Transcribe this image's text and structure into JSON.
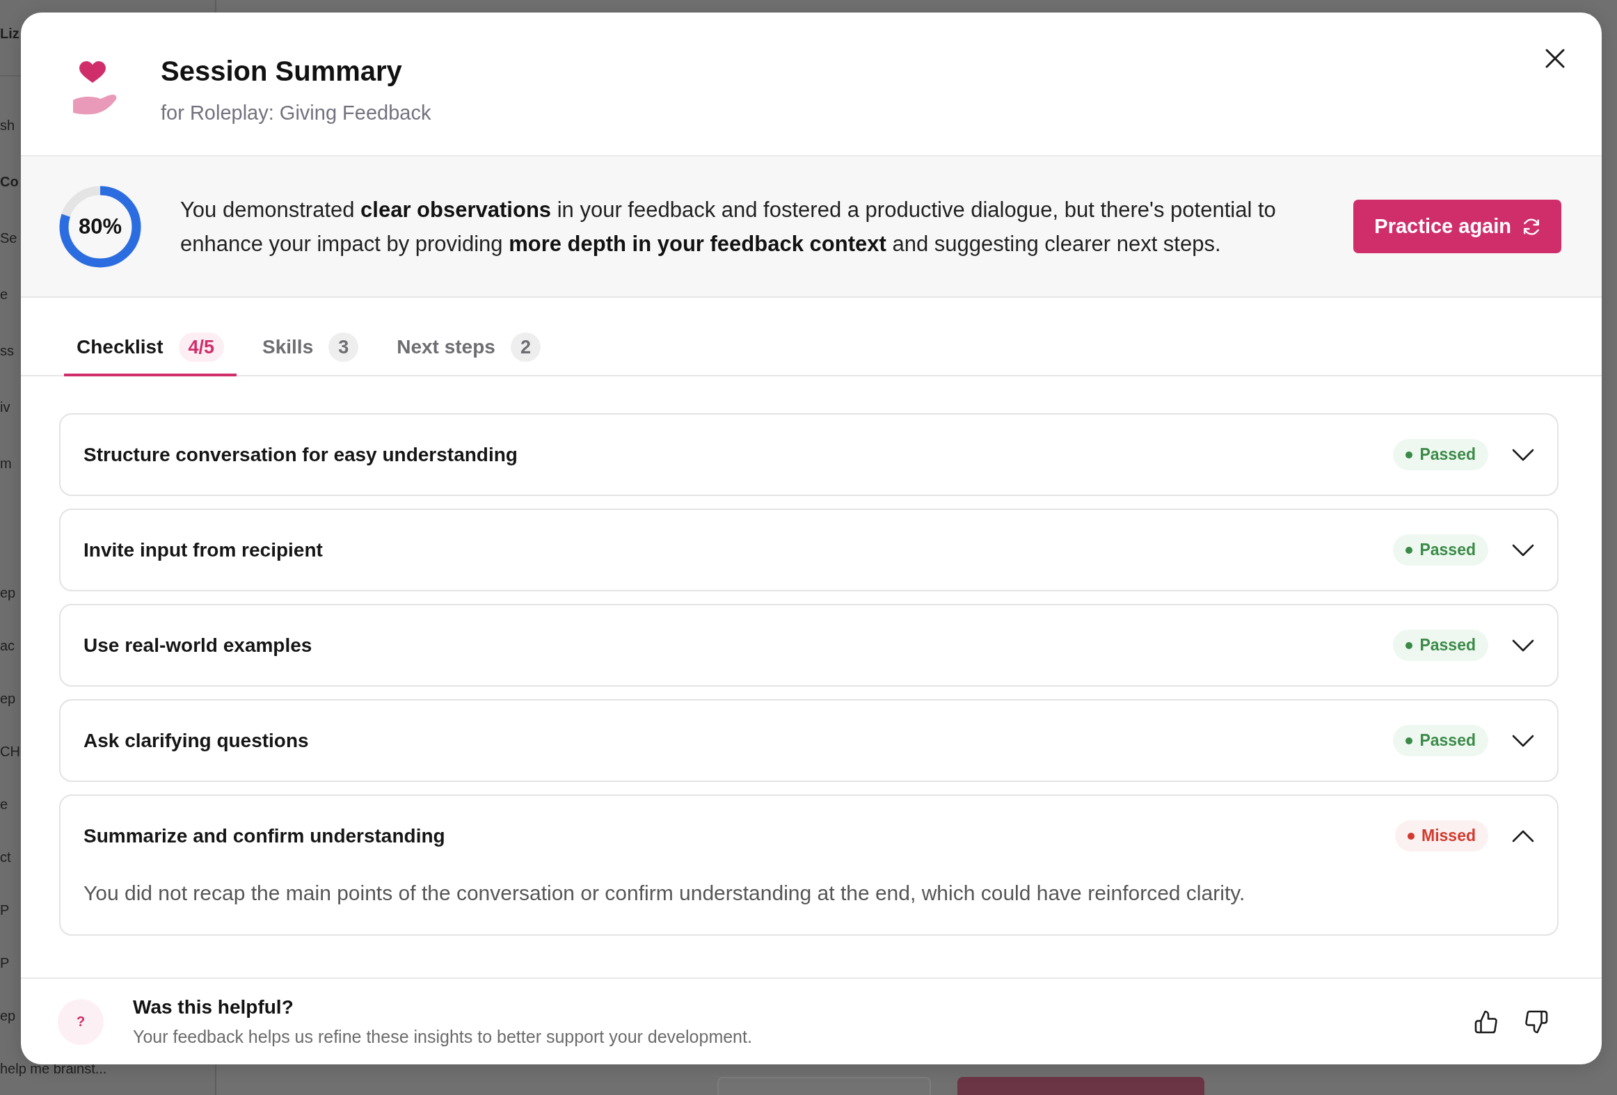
{
  "backdrop": {
    "sidebar": {
      "groups": [
        {
          "items": [
            {
              "text": "Liz",
              "kind": "heading"
            }
          ]
        },
        {
          "items": [
            {
              "text": "sh",
              "kind": "item"
            },
            {
              "text": "Co",
              "kind": "heading"
            },
            {
              "text": "Se",
              "kind": "item"
            },
            {
              "text": "e",
              "kind": "item"
            },
            {
              "text": "ss",
              "kind": "item"
            },
            {
              "text": "iv",
              "kind": "item"
            },
            {
              "text": "m",
              "kind": "item"
            }
          ]
        },
        {
          "items": [
            {
              "text": "ep",
              "kind": "item"
            },
            {
              "text": "ac",
              "kind": "item"
            },
            {
              "text": "ep",
              "kind": "item"
            },
            {
              "text": "CH",
              "kind": "item"
            },
            {
              "text": "e",
              "kind": "item"
            },
            {
              "text": "ct",
              "kind": "item"
            },
            {
              "text": "P",
              "kind": "item"
            },
            {
              "text": "P",
              "kind": "item"
            },
            {
              "text": "ep",
              "kind": "item"
            },
            {
              "text": "help me brainst...",
              "kind": "item"
            }
          ]
        }
      ]
    }
  },
  "dialog": {
    "title": "Session Summary",
    "subtitle": "for Roleplay: Giving Feedback",
    "summary": {
      "score": "80%",
      "text": "You demonstrated **clear observations** in your feedback and fostered a productive dialogue, but there's potential to enhance your impact by providing **more depth in your feedback context** and suggesting clearer next steps.",
      "action": "Practice again"
    },
    "tabs": [
      {
        "label": "Checklist",
        "count": "4/5",
        "selected": true
      },
      {
        "label": "Skills",
        "count": "3",
        "selected": false
      },
      {
        "label": "Next steps",
        "count": "2",
        "selected": false
      }
    ],
    "checklist": [
      {
        "title": "Structure conversation for easy understanding",
        "passed": true,
        "status_label": "Passed",
        "expanded": false
      },
      {
        "title": "Invite input from recipient",
        "passed": true,
        "status_label": "Passed",
        "expanded": false
      },
      {
        "title": "Use real-world examples",
        "passed": true,
        "status_label": "Passed",
        "expanded": false
      },
      {
        "title": "Ask clarifying questions",
        "passed": true,
        "status_label": "Passed",
        "expanded": false
      },
      {
        "title": "Summarize and confirm understanding",
        "passed": false,
        "status_label": "Missed",
        "expanded": true,
        "detail": "You did not recap the main points of the conversation or confirm understanding at the end, which could have reinforced clarity."
      }
    ],
    "feedback": {
      "icon_glyph": "?",
      "title": "Was this helpful?",
      "text": "Your feedback helps us refine these insights to better support your development."
    }
  }
}
